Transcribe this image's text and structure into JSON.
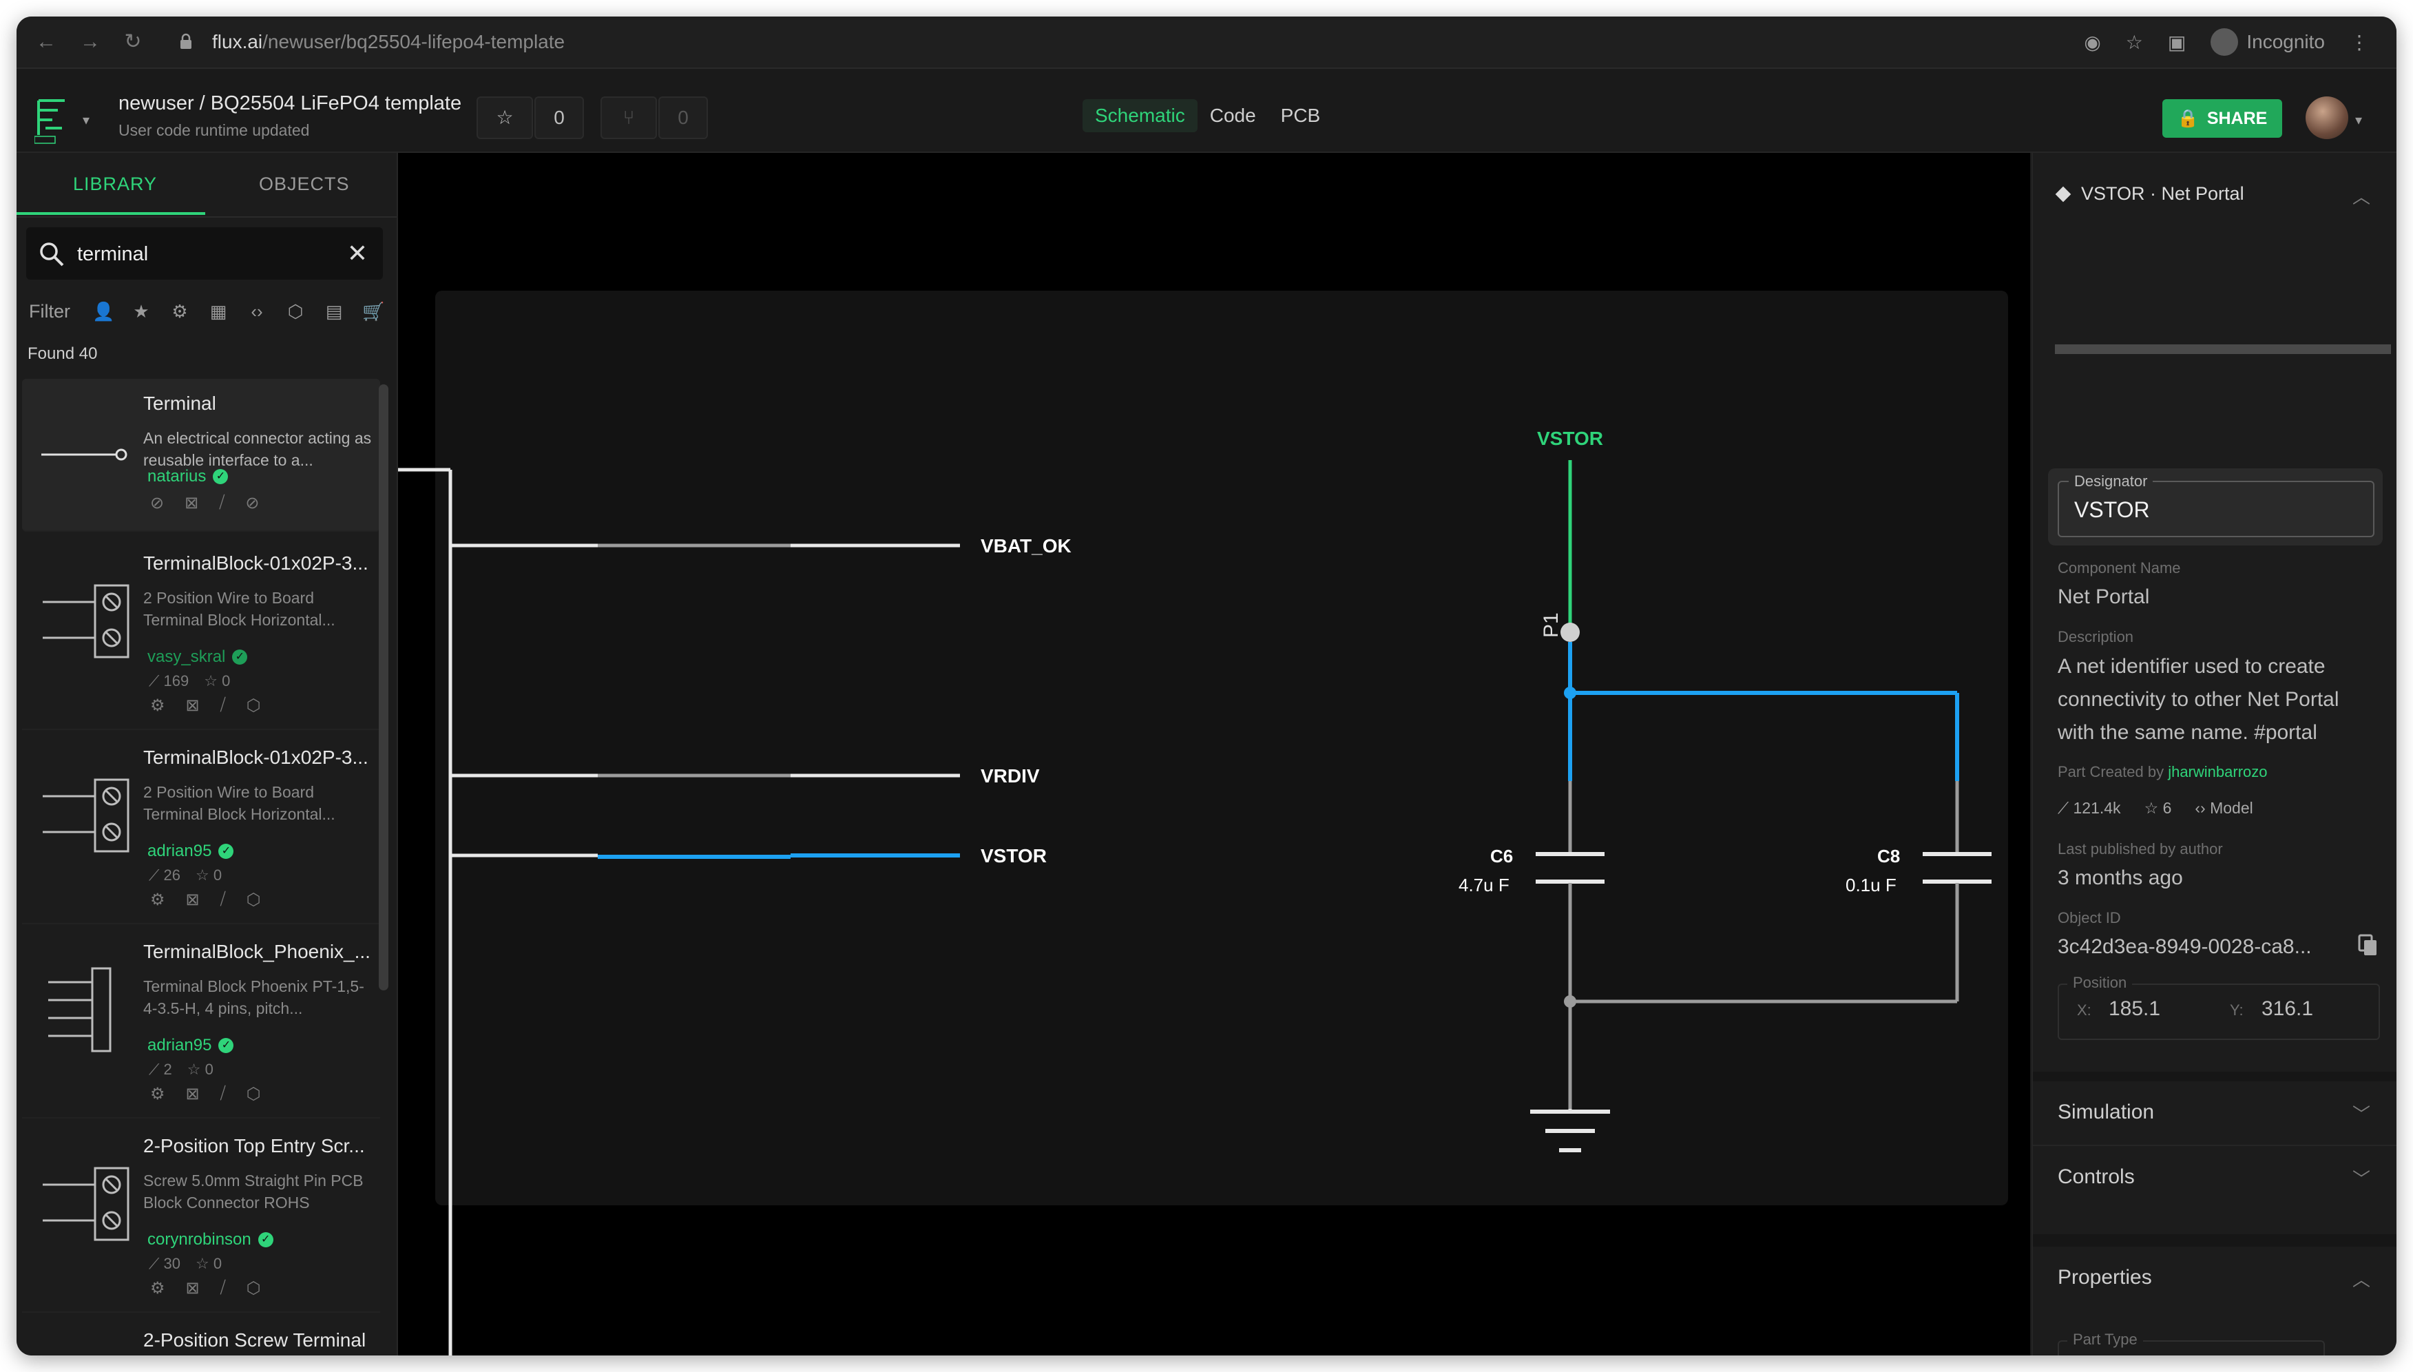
{
  "browser": {
    "url_host": "flux.ai",
    "url_path": "/newuser/bq25504-lifepo4-template",
    "profile": "Incognito"
  },
  "header": {
    "breadcrumb": "newuser / BQ25504 LiFePO4 template",
    "status": "User code runtime updated",
    "star_count": "0",
    "fork_count": "0",
    "tabs": [
      {
        "label": "Schematic",
        "active": true
      },
      {
        "label": "Code",
        "active": false
      },
      {
        "label": "PCB",
        "active": false
      }
    ],
    "share_label": "SHARE",
    "accent_color": "#21a85a"
  },
  "library": {
    "tabs": [
      "LIBRARY",
      "OBJECTS"
    ],
    "search_value": "terminal",
    "filter_label": "Filter",
    "found": "Found 40",
    "items": [
      {
        "title": "Terminal",
        "desc": "An electrical connector acting as reusable interface to a...",
        "author": "natarius",
        "views": "",
        "stars": ""
      },
      {
        "title": "TerminalBlock-01x02P-3...",
        "desc": "2 Position Wire to Board Terminal Block Horizontal...",
        "author": "vasy_skral",
        "views": "169",
        "stars": "0"
      },
      {
        "title": "TerminalBlock-01x02P-3...",
        "desc": "2 Position Wire to Board Terminal Block Horizontal...",
        "author": "adrian95",
        "views": "26",
        "stars": "0"
      },
      {
        "title": "TerminalBlock_Phoenix_...",
        "desc": "Terminal Block Phoenix PT-1,5-4-3.5-H, 4 pins, pitch...",
        "author": "adrian95",
        "views": "2",
        "stars": "0"
      },
      {
        "title": "2-Position Top Entry Scr...",
        "desc": "Screw 5.0mm Straight Pin PCB Block Connector ROHS",
        "author": "corynrobinson",
        "views": "30",
        "stars": "0"
      },
      {
        "title": "2-Position Screw Terminal",
        "desc": "",
        "author": "",
        "views": "",
        "stars": ""
      }
    ]
  },
  "schematic": {
    "nets": [
      "VBAT_OK",
      "VRDIV",
      "VSTOR"
    ],
    "portal_label": "VSTOR",
    "pin_label": "P1",
    "components": [
      {
        "ref": "C6",
        "value": "4.7u F"
      },
      {
        "ref": "C8",
        "value": "0.1u F"
      }
    ],
    "colors": {
      "selected": "#1da1f2",
      "portal": "#2fd47a",
      "wire": "#bdbdbd"
    }
  },
  "inspector": {
    "title": "VSTOR · Net Portal",
    "designator_label": "Designator",
    "designator": "VSTOR",
    "component_name_label": "Component Name",
    "component_name": "Net Portal",
    "description_label": "Description",
    "description": "A net identifier used to create connectivity to other Net Portal with the same name. #portal",
    "created_by_label": "Part Created by",
    "created_by": "jharwinbarrozo",
    "views": "121.4k",
    "stars": "6",
    "model_label": "Model",
    "published_label": "Last published by author",
    "published": "3 months ago",
    "object_id_label": "Object ID",
    "object_id": "3c42d3ea-8949-0028-ca8...",
    "position_label": "Position",
    "x_label": "X:",
    "x": "185.1",
    "y_label": "Y:",
    "y": "316.1",
    "sections": [
      "Simulation",
      "Controls",
      "Properties"
    ],
    "part_type_label": "Part Type"
  }
}
